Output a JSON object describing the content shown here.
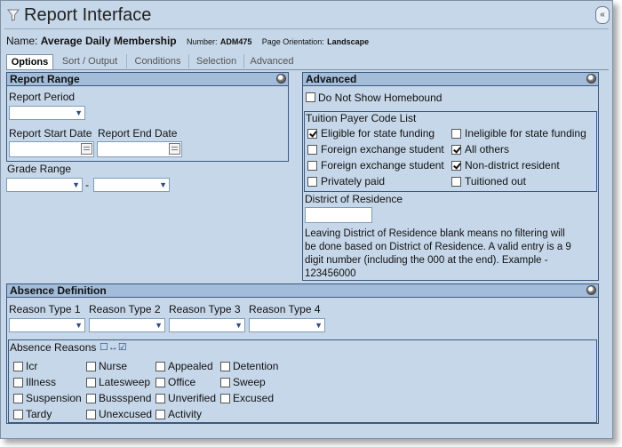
{
  "window": {
    "title": "Report Interface",
    "collapse_label": "«"
  },
  "report": {
    "name_label": "Name:",
    "name_value": "Average Daily Membership",
    "number_label": "Number:",
    "number_value": "ADM475",
    "orientation_label": "Page Orientation:",
    "orientation_value": "Landscape"
  },
  "tabs": [
    "Options",
    "Sort / Output",
    "Conditions",
    "Selection",
    "Advanced"
  ],
  "report_range": {
    "title": "Report Range",
    "period_label": "Report Period",
    "start_label": "Report Start Date",
    "end_label": "Report End Date",
    "grade_label": "Grade Range",
    "grade_sep": "-"
  },
  "advanced": {
    "title": "Advanced",
    "homebound_label": "Do Not Show Homebound",
    "tuition_title": "Tuition Payer Code List",
    "tuition_items": [
      {
        "label": "Eligible for state funding",
        "checked": true
      },
      {
        "label": "Ineligible for state funding",
        "checked": false
      },
      {
        "label": "Foreign exchange student",
        "checked": false
      },
      {
        "label": "All others",
        "checked": true
      },
      {
        "label": "Foreign exchange student",
        "checked": false
      },
      {
        "label": "Non-district resident",
        "checked": true
      },
      {
        "label": "Privately paid",
        "checked": false
      },
      {
        "label": "Tuitioned out",
        "checked": false
      }
    ],
    "district_label": "District of Residence",
    "district_note_1": "Leaving District of Residence blank means no filtering will",
    "district_note_2": "be done based on District of Residence. A valid entry is a 9",
    "district_note_3": "digit number (including the 000 at the end). Example -",
    "district_note_4": "123456000"
  },
  "absence": {
    "title": "Absence Definition",
    "reason_types": [
      "Reason Type 1",
      "Reason Type 2",
      "Reason Type 3",
      "Reason Type 4"
    ],
    "reasons_title": "Absence Reasons",
    "reasons": [
      "Icr",
      "Nurse",
      "Appealed",
      "Detention",
      "Illness",
      "Latesweep",
      "Office",
      "Sweep",
      "Suspension",
      "Bussspend",
      "Unverified",
      "Excused",
      "Tardy",
      "Unexcused",
      "Activity"
    ]
  }
}
